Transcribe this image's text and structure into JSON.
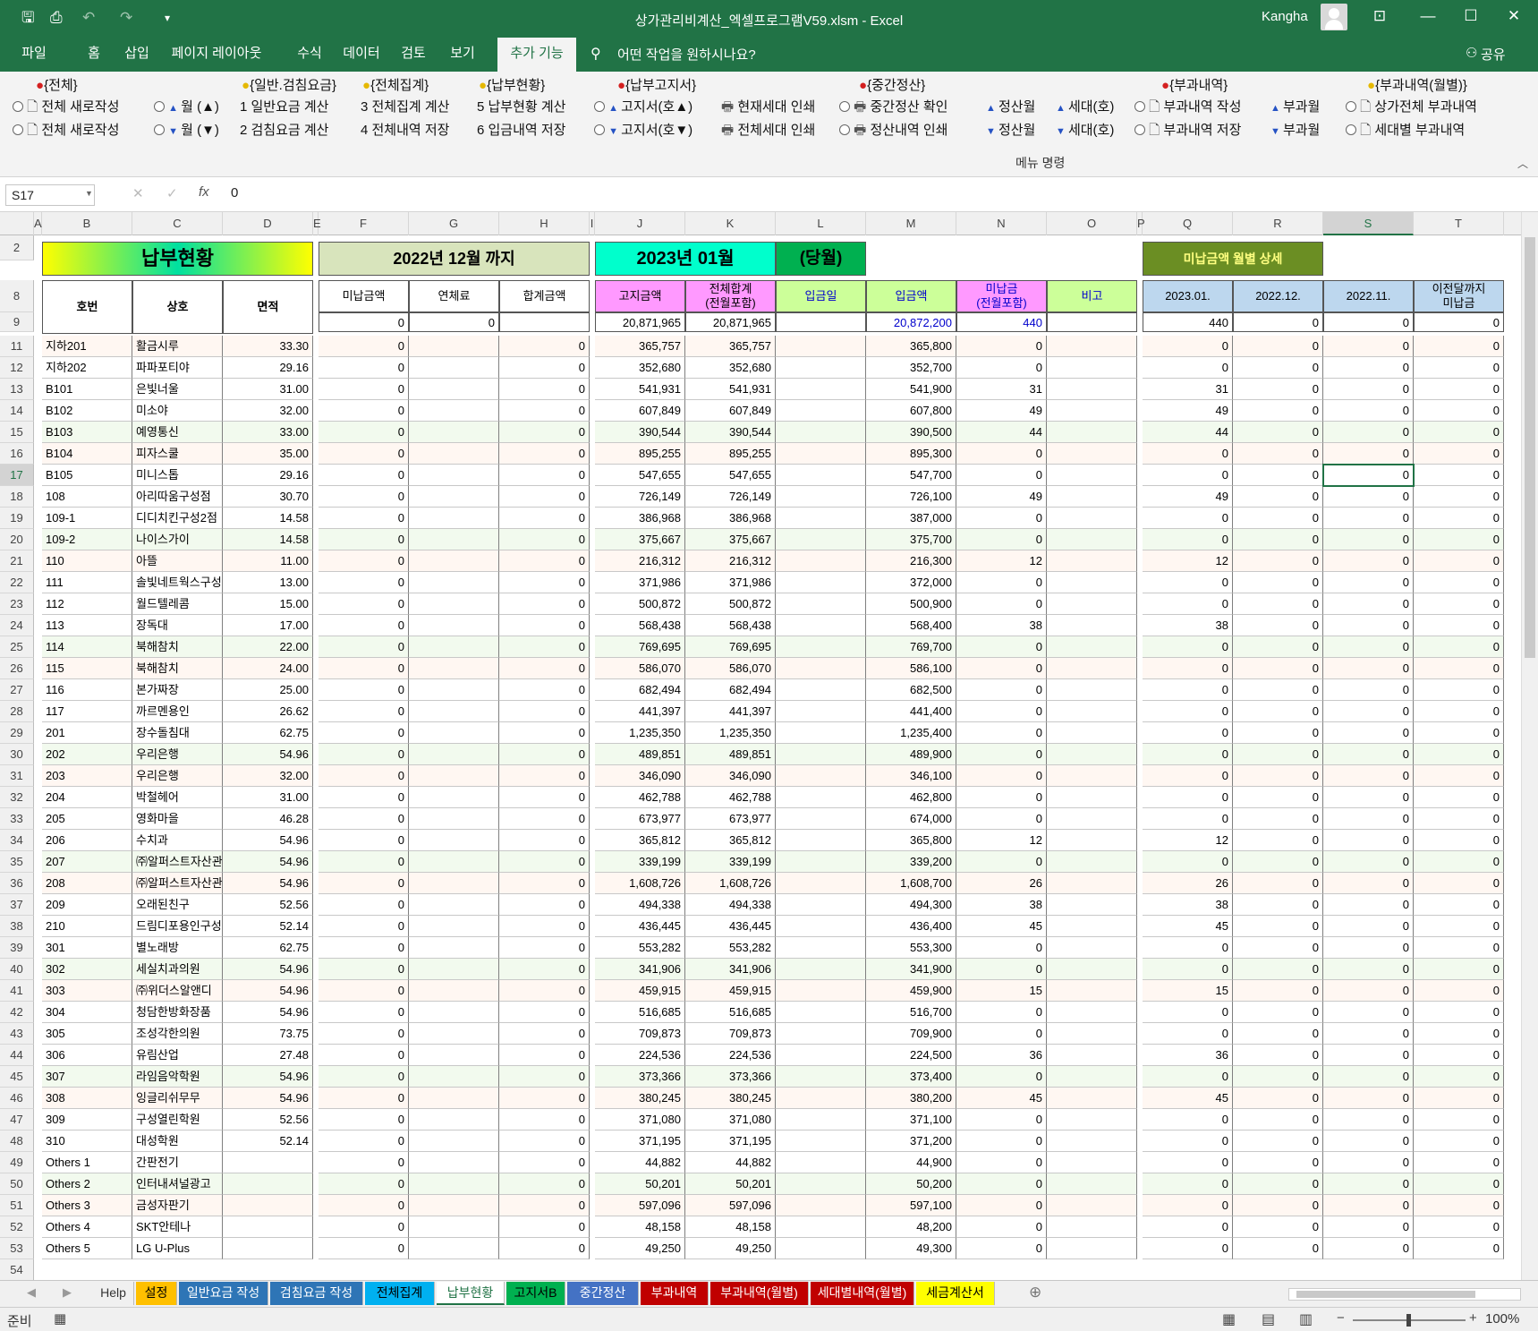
{
  "window": {
    "title": "상가관리비계산_엑셀프로그램V59.xlsm  -  Excel",
    "user": "Kangha"
  },
  "menu": {
    "tabs": [
      "파일",
      "홈",
      "삽입",
      "페이지 레이아웃",
      "수식",
      "데이터",
      "검토",
      "보기",
      "추가 기능"
    ],
    "tell_me": "어떤 작업을 원하시나요?",
    "share": "공유"
  },
  "ribbon": {
    "groups": [
      "{전체}",
      "{일반.검침요금}",
      "{전체집계}",
      "{납부현황}",
      "{납부고지서}",
      "{중간정산}",
      "{부과내역}",
      "{부과내역(월별)}"
    ],
    "row1": [
      "전체 새로작성",
      "월 (▲)",
      "1  일반요금 계산",
      "3  전체집계 계산",
      "5  납부현황 계산",
      "고지서(호▲)",
      "현재세대 인쇄",
      "중간정산 확인",
      "정산월",
      "세대(호)",
      "부과내역 작성",
      "부과월",
      "상가전체 부과내역"
    ],
    "row2": [
      "전체 새로작성",
      "월 (▼)",
      "2  검침요금 계산",
      "4  전체내역 저장",
      "6  입금내역 저장",
      "고지서(호▼)",
      "전체세대 인쇄",
      "정산내역 인쇄",
      "정산월",
      "세대(호)",
      "부과내역 저장",
      "부과월",
      "세대별 부과내역"
    ],
    "label": "메뉴 명령"
  },
  "formula_bar": {
    "name_box": "S17",
    "value": "0"
  },
  "columns": [
    "A",
    "B",
    "C",
    "D",
    "E",
    "F",
    "G",
    "H",
    "I",
    "J",
    "K",
    "L",
    "M",
    "N",
    "O",
    "P",
    "Q",
    "R",
    "S",
    "T"
  ],
  "sheet": {
    "title": "납부현황",
    "prev_month": "2022년 12월 까지",
    "cur_month": "2023년 01월",
    "cur_label": "(당월)",
    "detail_label": "미납금액 월별 상세",
    "headers": {
      "ho": "호번",
      "name": "상호",
      "area": "면적",
      "unpaid": "미납금액",
      "late": "연체료",
      "sum": "합계금액",
      "billed": "고지금액",
      "total": "전체합계\n(전월포함)",
      "paydate": "입금일",
      "paid": "입금액",
      "balance": "미납금\n(전월포함)",
      "note": "비고",
      "m1": "2023.01.",
      "m2": "2022.12.",
      "m3": "2022.11.",
      "prev": "이전달까지\n미납금"
    },
    "totals": {
      "unpaid": "0",
      "late": "0",
      "billed": "20,871,965",
      "total": "20,871,965",
      "paid": "20,872,200",
      "balance": "440",
      "m1": "440",
      "m2": "0",
      "m3": "0",
      "prev": "0"
    },
    "rows": [
      [
        "11",
        "지하201",
        "활금시루",
        "33.30",
        "365,757",
        "365,800",
        "0"
      ],
      [
        "12",
        "지하202",
        "파파포티야",
        "29.16",
        "352,680",
        "352,700",
        "0"
      ],
      [
        "13",
        "B101",
        "은빛너울",
        "31.00",
        "541,931",
        "541,900",
        "31"
      ],
      [
        "14",
        "B102",
        "미소야",
        "32.00",
        "607,849",
        "607,800",
        "49"
      ],
      [
        "15",
        "B103",
        "예영통신",
        "33.00",
        "390,544",
        "390,500",
        "44"
      ],
      [
        "16",
        "B104",
        "피자스쿨",
        "35.00",
        "895,255",
        "895,300",
        "0"
      ],
      [
        "17",
        "B105",
        "미니스톱",
        "29.16",
        "547,655",
        "547,700",
        "0"
      ],
      [
        "18",
        "108",
        "아리따움구성점",
        "30.70",
        "726,149",
        "726,100",
        "49"
      ],
      [
        "19",
        "109-1",
        "디디치킨구성2점",
        "14.58",
        "386,968",
        "387,000",
        "0"
      ],
      [
        "20",
        "109-2",
        "나이스가이",
        "14.58",
        "375,667",
        "375,700",
        "0"
      ],
      [
        "21",
        "110",
        "아뜰",
        "11.00",
        "216,312",
        "216,300",
        "12"
      ],
      [
        "22",
        "111",
        "솔빛네트웍스구성",
        "13.00",
        "371,986",
        "372,000",
        "0"
      ],
      [
        "23",
        "112",
        "월드텔레콤",
        "15.00",
        "500,872",
        "500,900",
        "0"
      ],
      [
        "24",
        "113",
        "장독대",
        "17.00",
        "568,438",
        "568,400",
        "38"
      ],
      [
        "25",
        "114",
        "북해참치",
        "22.00",
        "769,695",
        "769,700",
        "0"
      ],
      [
        "26",
        "115",
        "북해참치",
        "24.00",
        "586,070",
        "586,100",
        "0"
      ],
      [
        "27",
        "116",
        "본가짜장",
        "25.00",
        "682,494",
        "682,500",
        "0"
      ],
      [
        "28",
        "117",
        "까르멘용인",
        "26.62",
        "441,397",
        "441,400",
        "0"
      ],
      [
        "29",
        "201",
        "장수돌침대",
        "62.75",
        "1,235,350",
        "1,235,400",
        "0"
      ],
      [
        "30",
        "202",
        "우리은행",
        "54.96",
        "489,851",
        "489,900",
        "0"
      ],
      [
        "31",
        "203",
        "우리은행",
        "32.00",
        "346,090",
        "346,100",
        "0"
      ],
      [
        "32",
        "204",
        "박철헤어",
        "31.00",
        "462,788",
        "462,800",
        "0"
      ],
      [
        "33",
        "205",
        "영화마을",
        "46.28",
        "673,977",
        "674,000",
        "0"
      ],
      [
        "34",
        "206",
        "수치과",
        "54.96",
        "365,812",
        "365,800",
        "12"
      ],
      [
        "35",
        "207",
        "㈜알퍼스트자산관",
        "54.96",
        "339,199",
        "339,200",
        "0"
      ],
      [
        "36",
        "208",
        "㈜알퍼스트자산관",
        "54.96",
        "1,608,726",
        "1,608,700",
        "26"
      ],
      [
        "37",
        "209",
        "오래된친구",
        "52.56",
        "494,338",
        "494,300",
        "38"
      ],
      [
        "38",
        "210",
        "드림디포용인구성",
        "52.14",
        "436,445",
        "436,400",
        "45"
      ],
      [
        "39",
        "301",
        "별노래방",
        "62.75",
        "553,282",
        "553,300",
        "0"
      ],
      [
        "40",
        "302",
        "세실치과의원",
        "54.96",
        "341,906",
        "341,900",
        "0"
      ],
      [
        "41",
        "303",
        "㈜위더스알앤디",
        "54.96",
        "459,915",
        "459,900",
        "15"
      ],
      [
        "42",
        "304",
        "청담한방화장품",
        "54.96",
        "516,685",
        "516,700",
        "0"
      ],
      [
        "43",
        "305",
        "조성각한의원",
        "73.75",
        "709,873",
        "709,900",
        "0"
      ],
      [
        "44",
        "306",
        "유림산업",
        "27.48",
        "224,536",
        "224,500",
        "36"
      ],
      [
        "45",
        "307",
        "라임음악학원",
        "54.96",
        "373,366",
        "373,400",
        "0"
      ],
      [
        "46",
        "308",
        "잉글리쉬무무",
        "54.96",
        "380,245",
        "380,200",
        "45"
      ],
      [
        "47",
        "309",
        "구성열린학원",
        "52.56",
        "371,080",
        "371,100",
        "0"
      ],
      [
        "48",
        "310",
        "대성학원",
        "52.14",
        "371,195",
        "371,200",
        "0"
      ],
      [
        "49",
        "Others 1",
        "간판전기",
        "",
        "44,882",
        "44,900",
        "0"
      ],
      [
        "50",
        "Others 2",
        "인터내셔널광고",
        "",
        "50,201",
        "50,200",
        "0"
      ],
      [
        "51",
        "Others 3",
        "금성자판기",
        "",
        "597,096",
        "597,100",
        "0"
      ],
      [
        "52",
        "Others 4",
        "SKT안테나",
        "",
        "48,158",
        "48,200",
        "0"
      ],
      [
        "53",
        "Others 5",
        "LG U-Plus",
        "",
        "49,250",
        "49,300",
        "0"
      ]
    ]
  },
  "sheet_tabs": [
    {
      "label": "Help",
      "color": "#f0f0f0",
      "fg": "#333"
    },
    {
      "label": "설정",
      "color": "#ffc000",
      "fg": "#000"
    },
    {
      "label": "일반요금 작성",
      "color": "#2e75b6",
      "fg": "#fff"
    },
    {
      "label": "검침요금 작성",
      "color": "#2e75b6",
      "fg": "#fff"
    },
    {
      "label": "전체집계",
      "color": "#00b0f0",
      "fg": "#000"
    },
    {
      "label": "납부현황",
      "color": "#ffffff",
      "fg": "#217346"
    },
    {
      "label": "고지서B",
      "color": "#00b050",
      "fg": "#000"
    },
    {
      "label": "중간정산",
      "color": "#4472c4",
      "fg": "#fff"
    },
    {
      "label": "부과내역",
      "color": "#c00000",
      "fg": "#fff"
    },
    {
      "label": "부과내역(월별)",
      "color": "#c00000",
      "fg": "#fff"
    },
    {
      "label": "세대별내역(월별)",
      "color": "#c00000",
      "fg": "#fff"
    },
    {
      "label": "세금계산서",
      "color": "#ffff00",
      "fg": "#000"
    }
  ],
  "status": {
    "text": "준비",
    "zoom": "100%"
  }
}
